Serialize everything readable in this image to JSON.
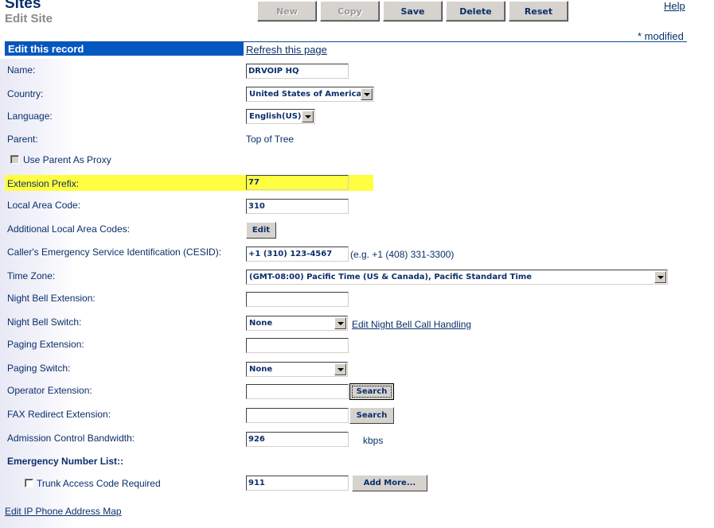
{
  "header": {
    "title": "Sites",
    "subtitle": "Edit Site",
    "help_label": "Help",
    "modified_note": "* modified"
  },
  "toolbar": {
    "new_label": "New",
    "copy_label": "Copy",
    "save_label": "Save",
    "delete_label": "Delete",
    "reset_label": "Reset",
    "new_disabled": true,
    "copy_disabled": true
  },
  "form": {
    "section_title": "Edit this record",
    "refresh_link": "Refresh this page",
    "name": {
      "label": "Name:",
      "value": "DRVOIP HQ"
    },
    "country": {
      "label": "Country:",
      "value": "United States of America"
    },
    "language": {
      "label": "Language:",
      "value": "English(US)"
    },
    "parent": {
      "label": "Parent:",
      "value": "Top of Tree"
    },
    "use_parent_proxy": {
      "label": "Use Parent As Proxy",
      "checked": false,
      "disabled": true
    },
    "extension_prefix": {
      "label": "Extension Prefix:",
      "value": "77",
      "highlight_color": "#ffff40"
    },
    "local_area_code": {
      "label": "Local Area Code:",
      "value": "310"
    },
    "additional_area_codes": {
      "label": "Additional Local Area Codes:",
      "button": "Edit"
    },
    "cesid": {
      "label": "Caller's Emergency Service Identification (CESID):",
      "value": "+1 (310) 123-4567",
      "hint": "(e.g. +1 (408) 331-3300)"
    },
    "time_zone": {
      "label": "Time Zone:",
      "value": "(GMT-08:00) Pacific Time (US & Canada), Pacific Standard Time"
    },
    "night_bell_extension": {
      "label": "Night Bell Extension:",
      "value": ""
    },
    "night_bell_switch": {
      "label": "Night Bell Switch:",
      "value": "None",
      "link": "Edit Night Bell Call Handling"
    },
    "paging_extension": {
      "label": "Paging Extension:",
      "value": ""
    },
    "paging_switch": {
      "label": "Paging Switch:",
      "value": "None"
    },
    "operator_extension": {
      "label": "Operator Extension:",
      "value": "",
      "button": "Search"
    },
    "fax_redirect_extension": {
      "label": "FAX Redirect Extension:",
      "value": "",
      "button": "Search"
    },
    "admission_bandwidth": {
      "label": "Admission Control Bandwidth:",
      "value": "926",
      "unit": "kbps"
    },
    "emergency_list": {
      "label": "Emergency Number List::"
    },
    "trunk_access": {
      "label": "Trunk Access Code Required",
      "checked": false,
      "value": "911",
      "button": "Add More..."
    },
    "ip_phone_map_link": "Edit IP Phone Address Map"
  },
  "colors": {
    "header_bar": "#0457c0",
    "text": "#0b2f6b",
    "highlight": "#ffff40"
  }
}
